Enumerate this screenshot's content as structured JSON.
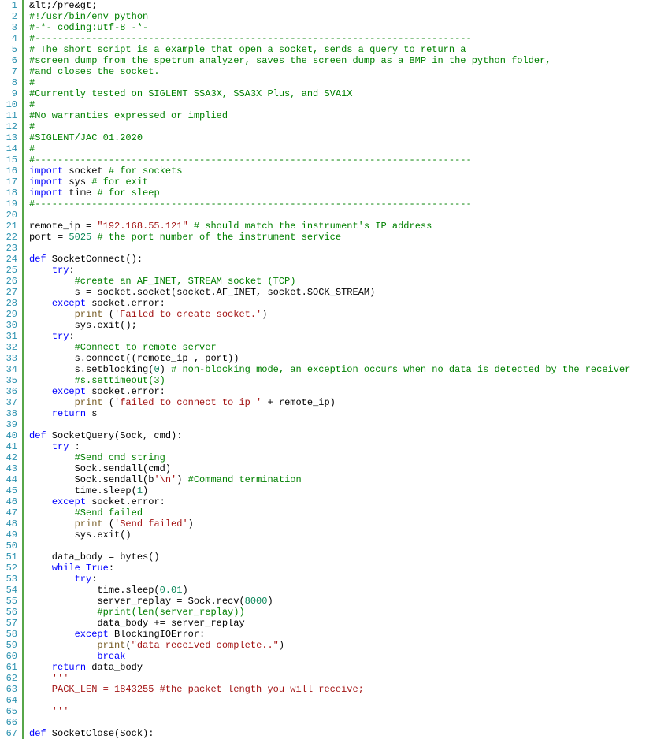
{
  "lines": [
    [
      {
        "cls": "c-text",
        "t": "&lt;/pre&gt;"
      }
    ],
    [
      {
        "cls": "c-comment",
        "t": "#!/usr/bin/env python"
      }
    ],
    [
      {
        "cls": "c-comment",
        "t": "#-*- coding:utf-8 -*-"
      }
    ],
    [
      {
        "cls": "c-comment",
        "t": "#-----------------------------------------------------------------------------"
      }
    ],
    [
      {
        "cls": "c-comment",
        "t": "# The short script is a example that open a socket, sends a query to return a"
      }
    ],
    [
      {
        "cls": "c-comment",
        "t": "#screen dump from the spetrum analyzer, saves the screen dump as a BMP in the python folder,"
      }
    ],
    [
      {
        "cls": "c-comment",
        "t": "#and closes the socket."
      }
    ],
    [
      {
        "cls": "c-comment",
        "t": "#"
      }
    ],
    [
      {
        "cls": "c-comment",
        "t": "#Currently tested on SIGLENT SSA3X, SSA3X Plus, and SVA1X"
      }
    ],
    [
      {
        "cls": "c-comment",
        "t": "#"
      }
    ],
    [
      {
        "cls": "c-comment",
        "t": "#No warranties expressed or implied"
      }
    ],
    [
      {
        "cls": "c-comment",
        "t": "#"
      }
    ],
    [
      {
        "cls": "c-comment",
        "t": "#SIGLENT/JAC 01.2020"
      }
    ],
    [
      {
        "cls": "c-comment",
        "t": "#"
      }
    ],
    [
      {
        "cls": "c-comment",
        "t": "#-----------------------------------------------------------------------------"
      }
    ],
    [
      {
        "cls": "c-keyword",
        "t": "import"
      },
      {
        "cls": "c-text",
        "t": " socket "
      },
      {
        "cls": "c-comment",
        "t": "# for sockets"
      }
    ],
    [
      {
        "cls": "c-keyword",
        "t": "import"
      },
      {
        "cls": "c-text",
        "t": " sys "
      },
      {
        "cls": "c-comment",
        "t": "# for exit"
      }
    ],
    [
      {
        "cls": "c-keyword",
        "t": "import"
      },
      {
        "cls": "c-text",
        "t": " time "
      },
      {
        "cls": "c-comment",
        "t": "# for sleep"
      }
    ],
    [
      {
        "cls": "c-comment",
        "t": "#-----------------------------------------------------------------------------"
      }
    ],
    [],
    [
      {
        "cls": "c-text",
        "t": "remote_ip = "
      },
      {
        "cls": "c-string",
        "t": "\"192.168.55.121\""
      },
      {
        "cls": "c-text",
        "t": " "
      },
      {
        "cls": "c-comment",
        "t": "# should match the instrument's IP address"
      }
    ],
    [
      {
        "cls": "c-text",
        "t": "port = "
      },
      {
        "cls": "c-number",
        "t": "5025"
      },
      {
        "cls": "c-text",
        "t": " "
      },
      {
        "cls": "c-comment",
        "t": "# the port number of the instrument service"
      }
    ],
    [],
    [
      {
        "cls": "c-keyword",
        "t": "def"
      },
      {
        "cls": "c-text",
        "t": " SocketConnect():"
      }
    ],
    [
      {
        "cls": "c-text",
        "t": "    "
      },
      {
        "cls": "c-keyword",
        "t": "try"
      },
      {
        "cls": "c-text",
        "t": ":"
      }
    ],
    [
      {
        "cls": "c-text",
        "t": "        "
      },
      {
        "cls": "c-comment",
        "t": "#create an AF_INET, STREAM socket (TCP)"
      }
    ],
    [
      {
        "cls": "c-text",
        "t": "        s = socket.socket(socket.AF_INET, socket.SOCK_STREAM)"
      }
    ],
    [
      {
        "cls": "c-text",
        "t": "    "
      },
      {
        "cls": "c-keyword",
        "t": "except"
      },
      {
        "cls": "c-text",
        "t": " socket.error:"
      }
    ],
    [
      {
        "cls": "c-text",
        "t": "        "
      },
      {
        "cls": "c-builtin",
        "t": "print"
      },
      {
        "cls": "c-text",
        "t": " ("
      },
      {
        "cls": "c-string",
        "t": "'Failed to create socket.'"
      },
      {
        "cls": "c-text",
        "t": ")"
      }
    ],
    [
      {
        "cls": "c-text",
        "t": "        sys.exit();"
      }
    ],
    [
      {
        "cls": "c-text",
        "t": "    "
      },
      {
        "cls": "c-keyword",
        "t": "try"
      },
      {
        "cls": "c-text",
        "t": ":"
      }
    ],
    [
      {
        "cls": "c-text",
        "t": "        "
      },
      {
        "cls": "c-comment",
        "t": "#Connect to remote server"
      }
    ],
    [
      {
        "cls": "c-text",
        "t": "        s.connect((remote_ip , port))"
      }
    ],
    [
      {
        "cls": "c-text",
        "t": "        s.setblocking("
      },
      {
        "cls": "c-number",
        "t": "0"
      },
      {
        "cls": "c-text",
        "t": ") "
      },
      {
        "cls": "c-comment",
        "t": "# non-blocking mode, an exception occurs when no data is detected by the receiver"
      }
    ],
    [
      {
        "cls": "c-text",
        "t": "        "
      },
      {
        "cls": "c-comment",
        "t": "#s.settimeout(3)"
      }
    ],
    [
      {
        "cls": "c-text",
        "t": "    "
      },
      {
        "cls": "c-keyword",
        "t": "except"
      },
      {
        "cls": "c-text",
        "t": " socket.error:"
      }
    ],
    [
      {
        "cls": "c-text",
        "t": "        "
      },
      {
        "cls": "c-builtin",
        "t": "print"
      },
      {
        "cls": "c-text",
        "t": " ("
      },
      {
        "cls": "c-string",
        "t": "'failed to connect to ip '"
      },
      {
        "cls": "c-text",
        "t": " + remote_ip)"
      }
    ],
    [
      {
        "cls": "c-text",
        "t": "    "
      },
      {
        "cls": "c-keyword",
        "t": "return"
      },
      {
        "cls": "c-text",
        "t": " s"
      }
    ],
    [],
    [
      {
        "cls": "c-keyword",
        "t": "def"
      },
      {
        "cls": "c-text",
        "t": " SocketQuery(Sock, cmd):"
      }
    ],
    [
      {
        "cls": "c-text",
        "t": "    "
      },
      {
        "cls": "c-keyword",
        "t": "try"
      },
      {
        "cls": "c-text",
        "t": " :"
      }
    ],
    [
      {
        "cls": "c-text",
        "t": "        "
      },
      {
        "cls": "c-comment",
        "t": "#Send cmd string"
      }
    ],
    [
      {
        "cls": "c-text",
        "t": "        Sock.sendall(cmd)"
      }
    ],
    [
      {
        "cls": "c-text",
        "t": "        Sock.sendall(b"
      },
      {
        "cls": "c-string",
        "t": "'\\n'"
      },
      {
        "cls": "c-text",
        "t": ") "
      },
      {
        "cls": "c-comment",
        "t": "#Command termination"
      }
    ],
    [
      {
        "cls": "c-text",
        "t": "        time.sleep("
      },
      {
        "cls": "c-number",
        "t": "1"
      },
      {
        "cls": "c-text",
        "t": ")"
      }
    ],
    [
      {
        "cls": "c-text",
        "t": "    "
      },
      {
        "cls": "c-keyword",
        "t": "except"
      },
      {
        "cls": "c-text",
        "t": " socket.error:"
      }
    ],
    [
      {
        "cls": "c-text",
        "t": "        "
      },
      {
        "cls": "c-comment",
        "t": "#Send failed"
      }
    ],
    [
      {
        "cls": "c-text",
        "t": "        "
      },
      {
        "cls": "c-builtin",
        "t": "print"
      },
      {
        "cls": "c-text",
        "t": " ("
      },
      {
        "cls": "c-string",
        "t": "'Send failed'"
      },
      {
        "cls": "c-text",
        "t": ")"
      }
    ],
    [
      {
        "cls": "c-text",
        "t": "        sys.exit()"
      }
    ],
    [],
    [
      {
        "cls": "c-text",
        "t": "    data_body = bytes()"
      }
    ],
    [
      {
        "cls": "c-text",
        "t": "    "
      },
      {
        "cls": "c-keyword",
        "t": "while"
      },
      {
        "cls": "c-text",
        "t": " "
      },
      {
        "cls": "c-bool",
        "t": "True"
      },
      {
        "cls": "c-text",
        "t": ":"
      }
    ],
    [
      {
        "cls": "c-text",
        "t": "        "
      },
      {
        "cls": "c-keyword",
        "t": "try"
      },
      {
        "cls": "c-text",
        "t": ":"
      }
    ],
    [
      {
        "cls": "c-text",
        "t": "            time.sleep("
      },
      {
        "cls": "c-number",
        "t": "0.01"
      },
      {
        "cls": "c-text",
        "t": ")"
      }
    ],
    [
      {
        "cls": "c-text",
        "t": "            server_replay = Sock.recv("
      },
      {
        "cls": "c-number",
        "t": "8000"
      },
      {
        "cls": "c-text",
        "t": ")"
      }
    ],
    [
      {
        "cls": "c-text",
        "t": "            "
      },
      {
        "cls": "c-comment",
        "t": "#print(len(server_replay))"
      }
    ],
    [
      {
        "cls": "c-text",
        "t": "            data_body += server_replay"
      }
    ],
    [
      {
        "cls": "c-text",
        "t": "        "
      },
      {
        "cls": "c-keyword",
        "t": "except"
      },
      {
        "cls": "c-text",
        "t": " BlockingIOError:"
      }
    ],
    [
      {
        "cls": "c-text",
        "t": "            "
      },
      {
        "cls": "c-builtin",
        "t": "print"
      },
      {
        "cls": "c-text",
        "t": "("
      },
      {
        "cls": "c-string",
        "t": "\"data received complete..\""
      },
      {
        "cls": "c-text",
        "t": ")"
      }
    ],
    [
      {
        "cls": "c-text",
        "t": "            "
      },
      {
        "cls": "c-keyword",
        "t": "break"
      }
    ],
    [
      {
        "cls": "c-text",
        "t": "    "
      },
      {
        "cls": "c-keyword",
        "t": "return"
      },
      {
        "cls": "c-text",
        "t": " data_body"
      }
    ],
    [
      {
        "cls": "c-text",
        "t": "    "
      },
      {
        "cls": "c-string",
        "t": "'''"
      }
    ],
    [
      {
        "cls": "c-string",
        "t": "    PACK_LEN = 1843255 #the packet length you will receive;"
      }
    ],
    [
      {
        "cls": "c-string",
        "t": ""
      }
    ],
    [
      {
        "cls": "c-string",
        "t": "    '''"
      }
    ],
    [],
    [
      {
        "cls": "c-keyword",
        "t": "def"
      },
      {
        "cls": "c-text",
        "t": " SocketClose(Sock):"
      }
    ]
  ]
}
